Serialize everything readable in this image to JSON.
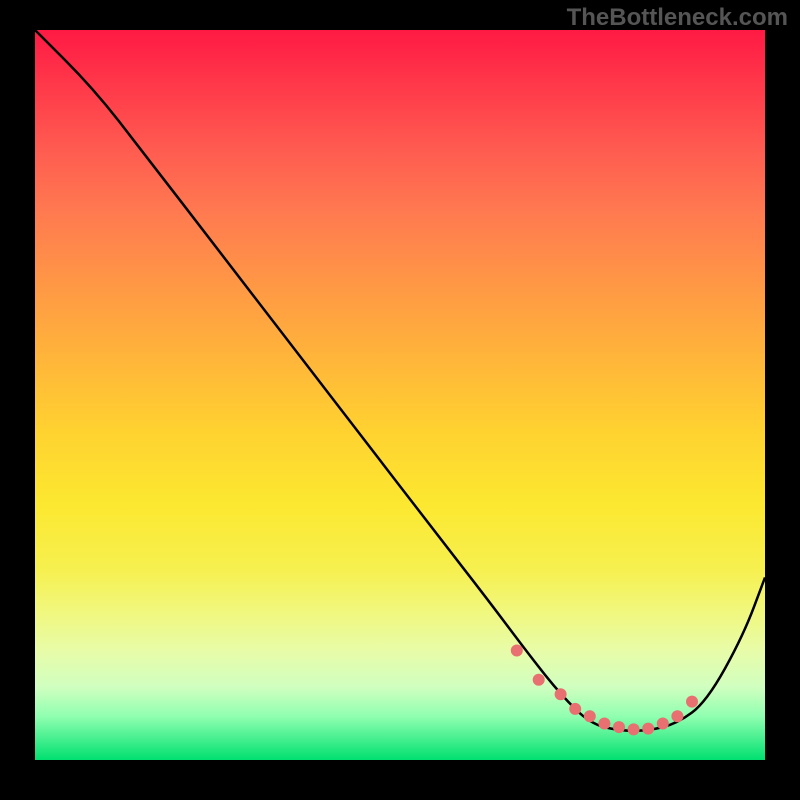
{
  "watermark": "TheBottleneck.com",
  "chart_data": {
    "type": "line",
    "title": "",
    "xlabel": "",
    "ylabel": "",
    "xlim": [
      0,
      100
    ],
    "ylim": [
      0,
      100
    ],
    "series": [
      {
        "name": "curve",
        "x": [
          0,
          8,
          15,
          25,
          35,
          45,
          55,
          62,
          68,
          72,
          76,
          80,
          84,
          88,
          92,
          97,
          100
        ],
        "values": [
          100,
          92,
          83,
          70,
          57,
          44,
          31,
          22,
          14,
          9,
          5,
          4,
          4,
          5,
          8,
          17,
          25
        ]
      }
    ],
    "markers": {
      "name": "highlight",
      "x": [
        66,
        69,
        72,
        74,
        76,
        78,
        80,
        82,
        84,
        86,
        88,
        90
      ],
      "values": [
        15,
        11,
        9,
        7,
        6,
        5,
        4.5,
        4.2,
        4.3,
        5,
        6,
        8
      ]
    },
    "gradient_stops": [
      {
        "pos": 0,
        "color": "#ff1a44"
      },
      {
        "pos": 50,
        "color": "#ffd230"
      },
      {
        "pos": 100,
        "color": "#00e070"
      }
    ]
  }
}
